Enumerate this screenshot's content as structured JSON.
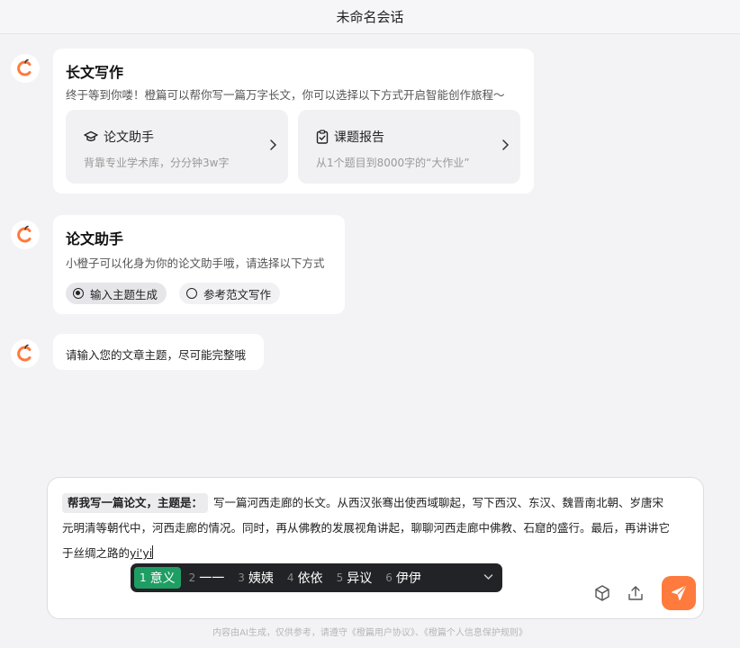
{
  "window": {
    "title": "未命名会话"
  },
  "brand": {
    "accent": "#ff7a3d",
    "ime_selected": "#1e9e63"
  },
  "messages": {
    "m1": {
      "title": "长文写作",
      "subtitle": "终于等到你喽！橙篇可以帮你写一篇万字长文，你可以选择以下方式开启智能创作旅程～",
      "cards": [
        {
          "icon": "graduation-cap-icon",
          "title": "论文助手",
          "desc": "背靠专业学术库，分分钟3w字"
        },
        {
          "icon": "clipboard-check-icon",
          "title": "课题报告",
          "desc": "从1个题目到8000字的“大作业”"
        }
      ]
    },
    "m2": {
      "title": "论文助手",
      "subtitle": "小橙子可以化身为你的论文助手哦，请选择以下方式",
      "options": [
        {
          "label": "输入主题生成",
          "selected": true
        },
        {
          "label": "参考范文写作",
          "selected": false
        }
      ]
    },
    "m3": {
      "text": "请输入您的文章主题，尽可能完整哦"
    }
  },
  "composer": {
    "prefix": "帮我写一篇论文，主题是：",
    "line1": "写一篇河西走廊的长文。从西汉张骞出使西域聊起，写下西汉、东汉、魏晋南北朝、岁唐宋",
    "line2": "元明清等朝代中，河西走廊的情况。同时，再从佛教的发展视角讲起，聊聊河西走廊中佛教、石窟的盛行。最后，再讲讲它",
    "line3": "于丝绸之路的",
    "composing": "yi'yi"
  },
  "ime": {
    "candidates": [
      {
        "num": "1",
        "text": "意义"
      },
      {
        "num": "2",
        "text": "一一"
      },
      {
        "num": "3",
        "text": "姨姨"
      },
      {
        "num": "4",
        "text": "依依"
      },
      {
        "num": "5",
        "text": "异议"
      },
      {
        "num": "6",
        "text": "伊伊"
      }
    ]
  },
  "footer": {
    "text": "内容由AI生成，仅供参考，请遵守《橙篇用户协议》、《橙篇个人信息保护规则》"
  }
}
